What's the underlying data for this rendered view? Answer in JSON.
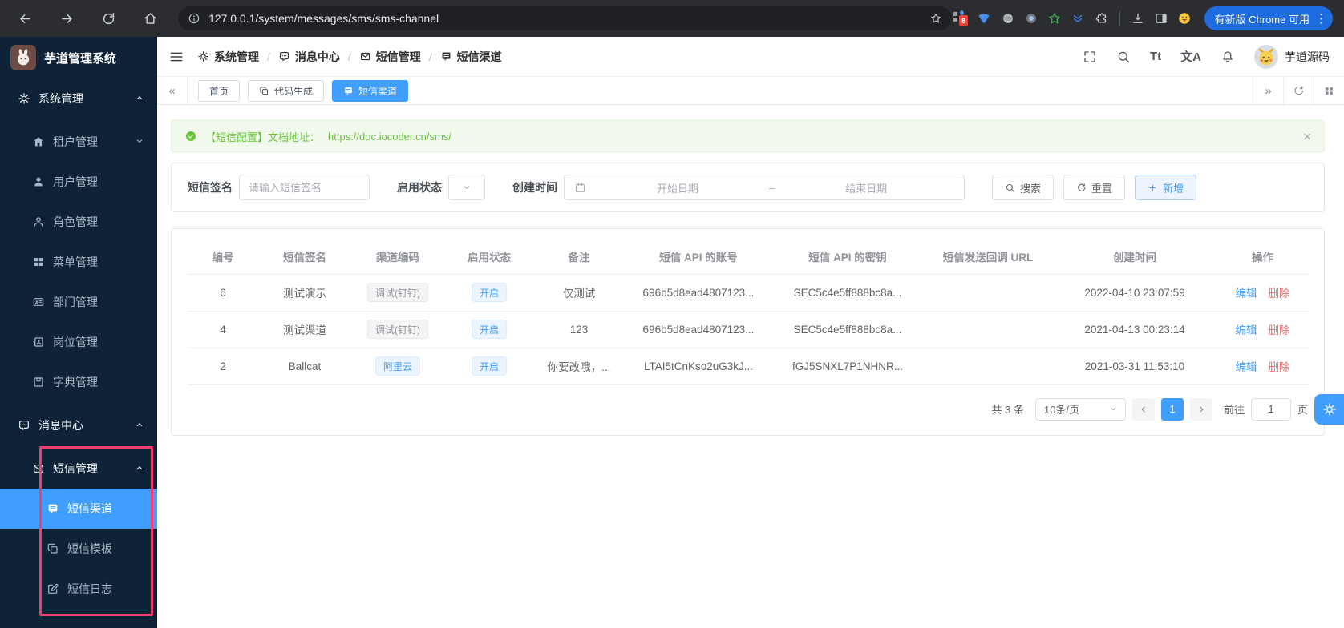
{
  "colors": {
    "accent": "#409eff",
    "success": "#67c23a",
    "danger": "#f56c6c",
    "highlight_pink": "#ee3f6f",
    "sidebar_bg": "#0e2338",
    "tag_info_text": "#909399"
  },
  "browser": {
    "url": "127.0.0.1/system/messages/sms/sms-channel",
    "update_button": "有新版 Chrome 可用",
    "kebab": "⋮",
    "ext_badge": "8"
  },
  "app": {
    "title": "芋道管理系统",
    "user": "芋道源码",
    "font_icon": "Tt",
    "locale_icon": "文A"
  },
  "breadcrumb": {
    "separator": "/",
    "items": [
      {
        "label": "系统管理"
      },
      {
        "label": "消息中心"
      },
      {
        "label": "短信管理"
      },
      {
        "label": "短信渠道"
      }
    ]
  },
  "tabbar": {
    "collapse": "«",
    "expand": "»",
    "tabs": [
      {
        "label": "首页"
      },
      {
        "label": "代码生成"
      },
      {
        "label": "短信渠道"
      }
    ]
  },
  "sidebar": {
    "items": [
      {
        "label": "系统管理"
      },
      {
        "label": "租户管理"
      },
      {
        "label": "用户管理"
      },
      {
        "label": "角色管理"
      },
      {
        "label": "菜单管理"
      },
      {
        "label": "部门管理"
      },
      {
        "label": "岗位管理"
      },
      {
        "label": "字典管理"
      },
      {
        "label": "消息中心"
      },
      {
        "label": "短信管理"
      },
      {
        "label": "短信渠道"
      },
      {
        "label": "短信模板"
      },
      {
        "label": "短信日志"
      }
    ]
  },
  "alert": {
    "prefix": "【短信配置】文档地址：",
    "link": "https://doc.iocoder.cn/sms/",
    "close": "×"
  },
  "filter": {
    "signature_label": "短信签名",
    "signature_placeholder": "请输入短信签名",
    "status_label": "启用状态",
    "time_label": "创建时间",
    "start_placeholder": "开始日期",
    "range_separator": "–",
    "end_placeholder": "结束日期",
    "search_button": "搜索",
    "reset_button": "重置",
    "add_button": "新增"
  },
  "table": {
    "columns": [
      "编号",
      "短信签名",
      "渠道编码",
      "启用状态",
      "备注",
      "短信 API 的账号",
      "短信 API 的密钥",
      "短信发送回调 URL",
      "创建时间",
      "操作"
    ],
    "rows": [
      {
        "id": "6",
        "signature": "测试演示",
        "channel_tag": "调试(钉钉)",
        "status_tag": "开启",
        "remark": "仅测试",
        "api_account": "696b5d8ead4807123...",
        "api_key": "SEC5c4e5ff888bc8a...",
        "callback_url": "",
        "created_at": "2022-04-10 23:07:59"
      },
      {
        "id": "4",
        "signature": "测试渠道",
        "channel_tag": "调试(钉钉)",
        "status_tag": "开启",
        "remark": "123",
        "api_account": "696b5d8ead4807123...",
        "api_key": "SEC5c4e5ff888bc8a...",
        "callback_url": "",
        "created_at": "2021-04-13 00:23:14"
      },
      {
        "id": "2",
        "signature": "Ballcat",
        "channel_tag": "阿里云",
        "status_tag": "开启",
        "remark": "你要改哦，...",
        "api_account": "LTAI5tCnKso2uG3kJ...",
        "api_key": "fGJ5SNXL7P1NHNR...",
        "callback_url": "",
        "created_at": "2021-03-31 11:53:10"
      }
    ],
    "actions": {
      "edit": "编辑",
      "delete": "删除"
    }
  },
  "pagination": {
    "total": "共 3 条",
    "page_size": "10条/页",
    "current_page": "1",
    "goto_label": "前往",
    "goto_value": "1",
    "unit": "页"
  }
}
